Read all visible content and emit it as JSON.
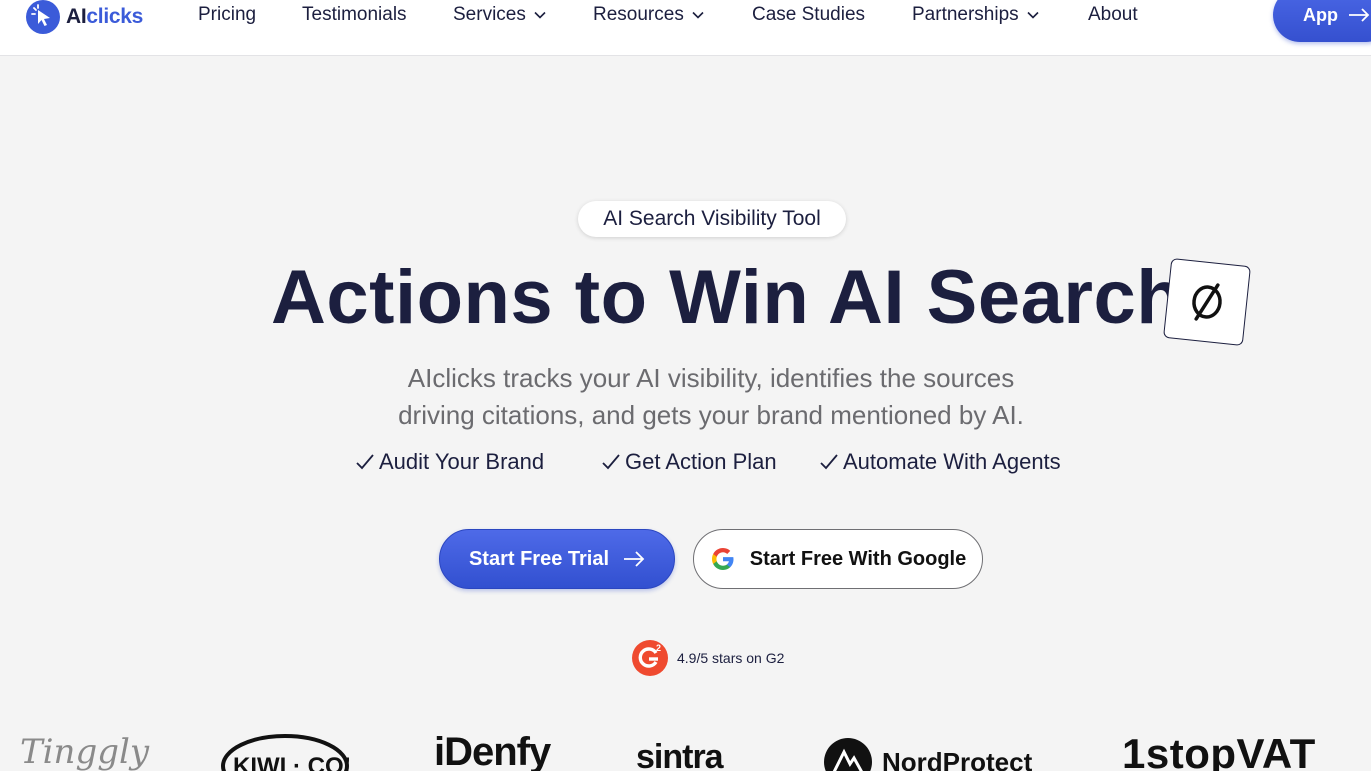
{
  "brand": {
    "name_ai": "AI",
    "name_clicks": "clicks"
  },
  "nav": {
    "items": [
      {
        "label": "Pricing",
        "dropdown": false
      },
      {
        "label": "Testimonials",
        "dropdown": false
      },
      {
        "label": "Services",
        "dropdown": true
      },
      {
        "label": "Resources",
        "dropdown": true
      },
      {
        "label": "Case Studies",
        "dropdown": false
      },
      {
        "label": "Partnerships",
        "dropdown": true
      },
      {
        "label": "About",
        "dropdown": false
      }
    ],
    "app_button": "App"
  },
  "hero": {
    "badge": "AI Search Visibility Tool",
    "title": "Actions to Win AI Search",
    "subtitle_line1": "AIclicks tracks your AI visibility, identifies the sources",
    "subtitle_line2": "driving citations, and gets your brand mentioned by AI.",
    "checks": [
      "Audit Your Brand",
      "Get Action Plan",
      "Automate With Agents"
    ],
    "primary_cta": "Start Free Trial",
    "google_cta": "Start Free With Google",
    "rating": "4.9/5 stars on G2"
  },
  "logos": {
    "tinggly": "Tinggly",
    "kiwi": "KIWI · COM",
    "idenfy": "iDenfy",
    "sintra": "sintra",
    "nord": "NordProtect",
    "stopvat": "1stopVAT"
  },
  "colors": {
    "accent": "#3b5bd9",
    "text_dark": "#1c1f3f",
    "text_muted": "#6b6b6f",
    "background": "#f4f4f4",
    "g2_red": "#ef4a2f"
  }
}
